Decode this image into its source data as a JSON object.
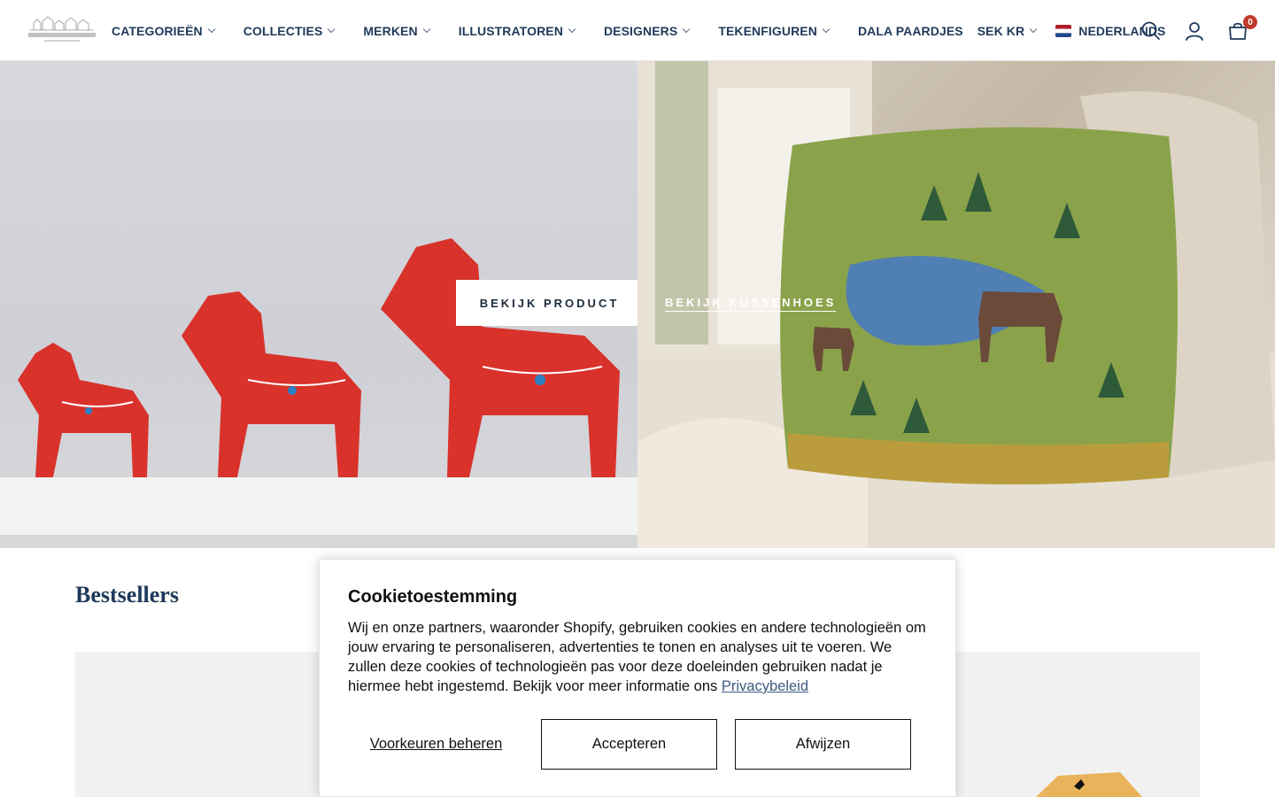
{
  "header": {
    "nav": [
      {
        "label": "CATEGORIEËN",
        "has_dropdown": true
      },
      {
        "label": "COLLECTIES",
        "has_dropdown": true
      },
      {
        "label": "MERKEN",
        "has_dropdown": true
      },
      {
        "label": "ILLUSTRATOREN",
        "has_dropdown": true
      },
      {
        "label": "DESIGNERS",
        "has_dropdown": true
      },
      {
        "label": "TEKENFIGUREN",
        "has_dropdown": true
      },
      {
        "label": "DALA PAARDJES",
        "has_dropdown": false
      }
    ],
    "currency": "SEK KR",
    "language": "NEDERLANDS",
    "cart_count": "0",
    "icons": [
      "search-icon",
      "account-icon",
      "cart-icon"
    ]
  },
  "hero": {
    "left_button": "BEKIJK PRODUCT",
    "right_link": "BEKIJK KUSSENHOES"
  },
  "bestsellers": {
    "title": "Bestsellers"
  },
  "cookie": {
    "title": "Cookietoestemming",
    "text": "Wij en onze partners, waaronder Shopify, gebruiken cookies en andere technologieën om jouw ervaring te personaliseren, advertenties te tonen en analyses uit te voeren. We zullen deze cookies of technologieën pas voor deze doeleinden gebruiken nadat je hiermee hebt ingestemd. Bekijk voor meer informatie ons",
    "link": "Privacybeleid",
    "prefs_button": "Voorkeuren beheren",
    "accept_button": "Accepteren",
    "decline_button": "Afwijzen"
  },
  "colors": {
    "brand_navy": "#1f3a5a",
    "badge_red": "#c0392b"
  }
}
